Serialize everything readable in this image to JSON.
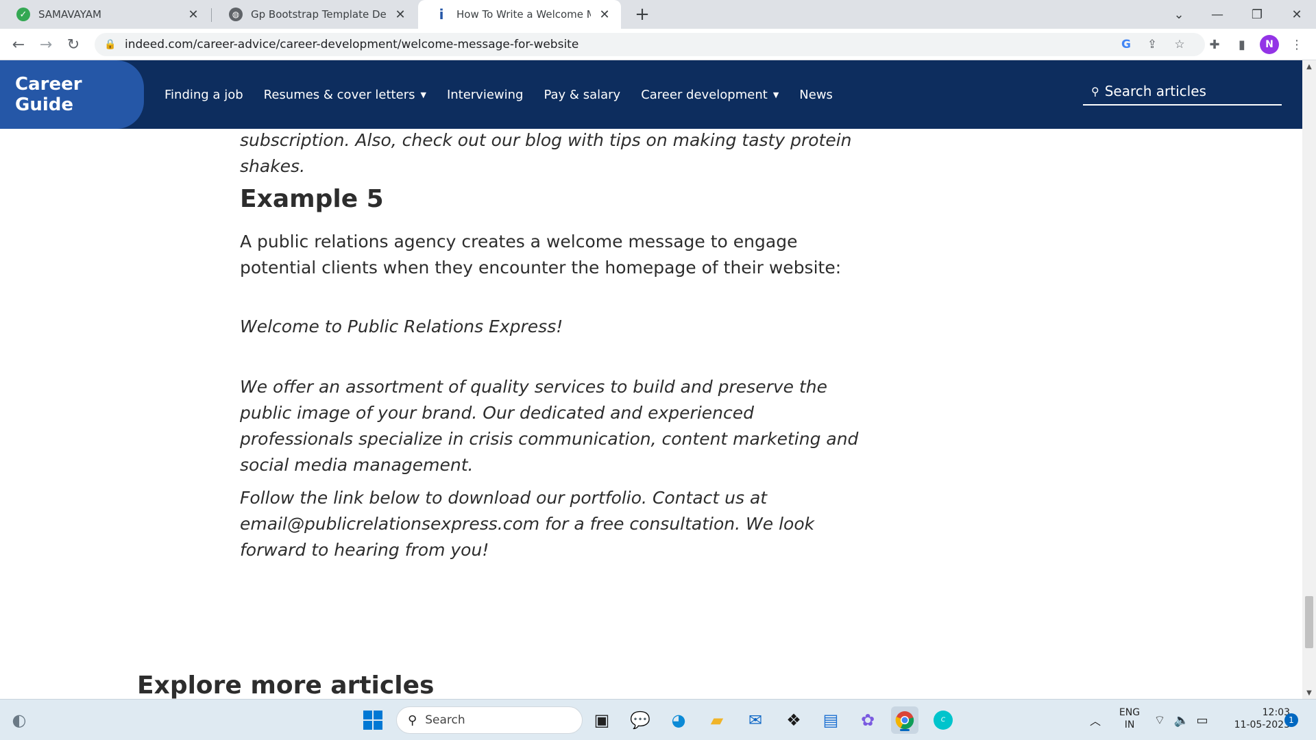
{
  "browser": {
    "tabs": [
      {
        "title": "SAMAVAYAM",
        "active": false
      },
      {
        "title": "Gp Bootstrap Template Demo",
        "active": false
      },
      {
        "title": "How To Write a Welcome Messa",
        "active": true
      }
    ],
    "url": "indeed.com/career-advice/career-development/welcome-message-for-website",
    "profile_initial": "N"
  },
  "site": {
    "brand": "Career Guide",
    "nav": [
      {
        "label": "Finding a job",
        "dropdown": false
      },
      {
        "label": "Resumes & cover letters",
        "dropdown": true
      },
      {
        "label": "Interviewing",
        "dropdown": false
      },
      {
        "label": "Pay & salary",
        "dropdown": false
      },
      {
        "label": "Career development",
        "dropdown": true
      },
      {
        "label": "News",
        "dropdown": false
      }
    ],
    "search_placeholder": "Search articles",
    "colors": {
      "header": "#0d2d5e",
      "brand": "#2557a7"
    }
  },
  "article": {
    "prev_tail": "subscription. Also, check out our blog with tips on making tasty protein shakes.",
    "heading": "Example 5",
    "intro": "A public relations agency creates a welcome message to engage potential clients when they encounter the homepage of their website:",
    "quote1": "Welcome to Public Relations Express!",
    "quote2": "We offer an assortment of quality services to build and preserve the public image of your brand. Our dedicated and experienced professionals specialize in crisis communication, content marketing and social media management.",
    "quote3": "Follow the link below to download our portfolio. Contact us at email@publicrelationsexpress.com for a free consultation. We look forward to hearing from you!",
    "explore_heading": "Explore more articles"
  },
  "taskbar": {
    "search_label": "Search",
    "lang_top": "ENG",
    "lang_bottom": "IN",
    "time": "12:03",
    "date": "11-05-2023",
    "notification_count": "1"
  }
}
